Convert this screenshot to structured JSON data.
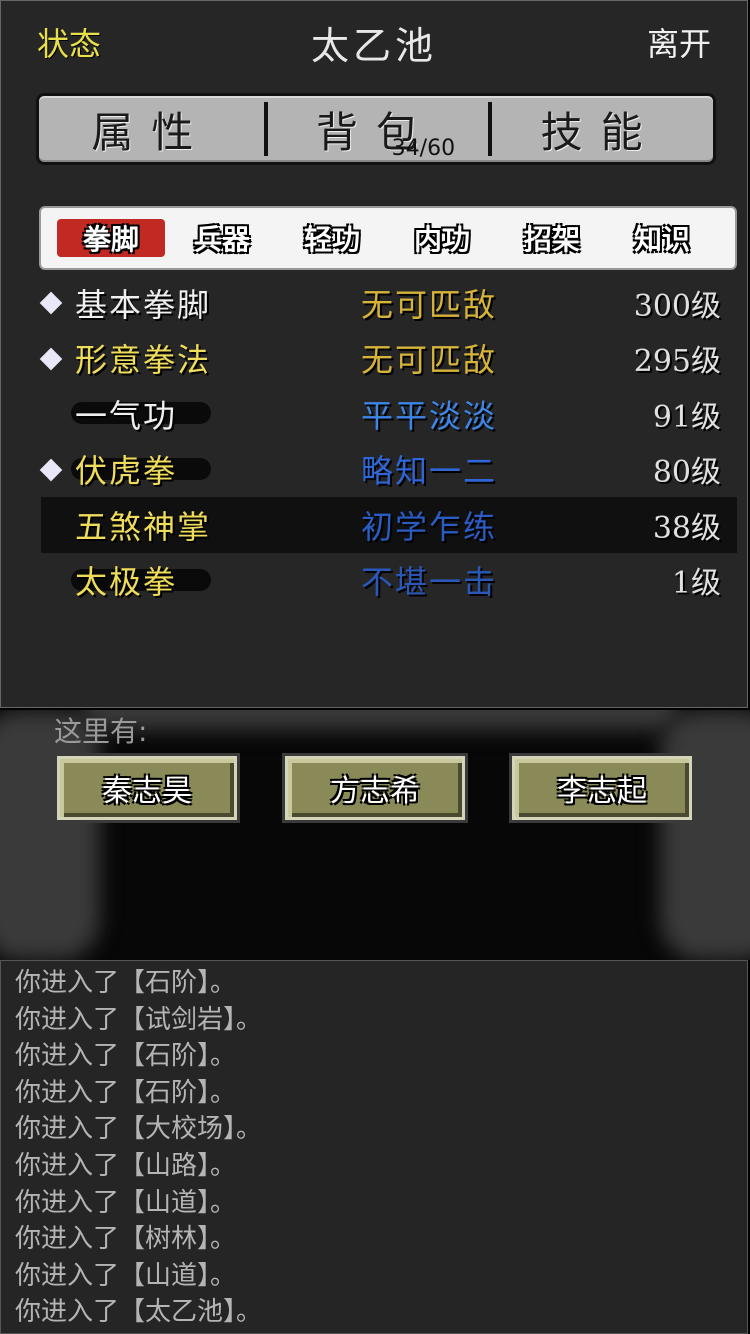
{
  "header": {
    "left_label": "状态",
    "title": "太乙池",
    "right_label": "离开"
  },
  "main_tabs": [
    {
      "label": "属性"
    },
    {
      "label": "背包",
      "count": "34/60"
    },
    {
      "label": "技能"
    }
  ],
  "sub_tabs": [
    "拳脚",
    "兵器",
    "轻功",
    "内功",
    "招架",
    "知识"
  ],
  "active_sub_tab": "拳脚",
  "skills": [
    {
      "name": "基本拳脚",
      "level_text": "无可匹敌",
      "level": "300级",
      "marked": true,
      "level_color": "#d6b43a"
    },
    {
      "name": "形意拳法",
      "level_text": "无可匹敌",
      "level": "295级",
      "marked": true,
      "level_color": "#d6b43a"
    },
    {
      "name": "一气功",
      "level_text": "平平淡淡",
      "level": "91级",
      "marked": false,
      "level_color": "#3d86e8"
    },
    {
      "name": "伏虎拳",
      "level_text": "略知一二",
      "level": "80级",
      "marked": true,
      "level_color": "#2f66d8"
    },
    {
      "name": "五煞神掌",
      "level_text": "初学乍练",
      "level": "38级",
      "marked": false,
      "level_color": "#2a5cc4"
    },
    {
      "name": "太极拳",
      "level_text": "不堪一击",
      "level": "1级",
      "marked": false,
      "level_color": "#2a58b8"
    }
  ],
  "here": {
    "label": "这里有:",
    "npcs": [
      "秦志昊",
      "方志希",
      "李志起"
    ]
  },
  "log": [
    "你进入了【石阶】。",
    "你进入了【试剑岩】。",
    "你进入了【石阶】。",
    "你进入了【石阶】。",
    "你进入了【大校场】。",
    "你进入了【山路】。",
    "你进入了【山道】。",
    "你进入了【树林】。",
    "你进入了【山道】。",
    "你进入了【太乙池】。"
  ]
}
